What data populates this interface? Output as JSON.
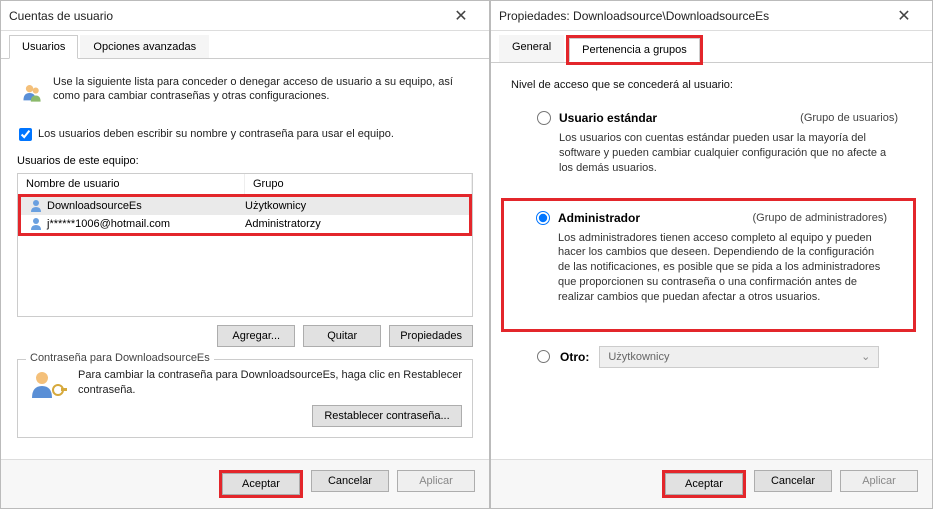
{
  "window1": {
    "title": "Cuentas de usuario",
    "tabs": {
      "users": "Usuarios",
      "advanced": "Opciones avanzadas"
    },
    "intro": "Use la siguiente lista para conceder o denegar acceso de usuario a su equipo, así como para cambiar contraseñas y otras configuraciones.",
    "checkbox_label": "Los usuarios deben escribir su nombre y contraseña para usar el equipo.",
    "list_header": "Usuarios de este equipo:",
    "table": {
      "col1": "Nombre de usuario",
      "col2": "Grupo",
      "rows": [
        {
          "name": "DownloadsourceEs",
          "group": "Użytkownicy"
        },
        {
          "name": "j******1006@hotmail.com",
          "group": "Administratorzy"
        }
      ]
    },
    "buttons": {
      "add": "Agregar...",
      "remove": "Quitar",
      "properties": "Propiedades"
    },
    "password_group": {
      "title": "Contraseña para DownloadsourceEs",
      "text": "Para cambiar la contraseña para DownloadsourceEs, haga clic en Restablecer contraseña.",
      "reset": "Restablecer contraseña..."
    },
    "footer": {
      "ok": "Aceptar",
      "cancel": "Cancelar",
      "apply": "Aplicar"
    }
  },
  "window2": {
    "title": "Propiedades: Downloadsource\\DownloadsourceEs",
    "tabs": {
      "general": "General",
      "membership": "Pertenencia a grupos"
    },
    "access_label": "Nivel de acceso que se concederá al usuario:",
    "standard": {
      "title": "Usuario estándar",
      "group": "(Grupo de usuarios)",
      "desc": "Los usuarios con cuentas estándar pueden usar la mayoría del software y pueden cambiar cualquier configuración que no afecte a los demás usuarios."
    },
    "admin": {
      "title": "Administrador",
      "group": "(Grupo de administradores)",
      "desc": "Los administradores tienen acceso completo al equipo y pueden hacer los cambios que deseen. Dependiendo de la configuración de las notificaciones, es posible que se pida a los administradores que proporcionen su contraseña o una confirmación antes de realizar cambios que puedan afectar a otros usuarios."
    },
    "other": {
      "title": "Otro:",
      "select": "Użytkownicy"
    },
    "footer": {
      "ok": "Aceptar",
      "cancel": "Cancelar",
      "apply": "Aplicar"
    }
  }
}
